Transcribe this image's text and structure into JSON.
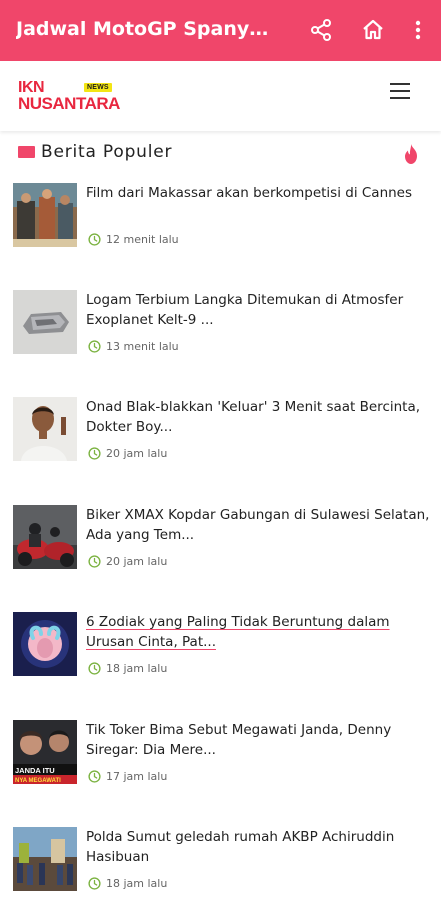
{
  "appbar": {
    "title": "Jadwal MotoGP Spanyol...",
    "icons": [
      "share-icon",
      "home-icon",
      "more-vert-icon"
    ],
    "color": "#f0466a"
  },
  "header": {
    "logo_line1": "IKN",
    "logo_line2": "NUSANTARA",
    "logo_badge": "NEWS",
    "logo_color": "#e8273f",
    "badge_color": "#f3e514"
  },
  "section": {
    "title": "Berita Populer",
    "icon": "fire-icon"
  },
  "articles": [
    {
      "headline": "Film dari Makassar akan berkompetisi di Cannes",
      "time": "12 menit lalu",
      "visited": false
    },
    {
      "headline": "Logam Terbium Langka Ditemukan di Atmosfer Exoplanet Kelt-9 ...",
      "time": "13 menit lalu",
      "visited": false
    },
    {
      "headline": "Onad Blak-blakkan 'Keluar' 3 Menit saat Bercinta, Dokter Boy...",
      "time": "20 jam lalu",
      "visited": false
    },
    {
      "headline": "Biker XMAX Kopdar Gabungan di Sulawesi Selatan, Ada yang Tem...",
      "time": "20 jam lalu",
      "visited": false
    },
    {
      "headline": "6 Zodiak yang Paling Tidak Beruntung dalam Urusan Cinta, Pat...",
      "time": "18 jam lalu",
      "visited": true
    },
    {
      "headline": "Tik Toker Bima Sebut Megawati Janda, Denny Siregar: Dia Mere...",
      "time": "17 jam lalu",
      "visited": false
    },
    {
      "headline": "Polda Sumut geledah rumah AKBP Achiruddin Hasibuan",
      "time": "18 jam lalu",
      "visited": false
    }
  ],
  "thumb_texts": {
    "item6_line1": "JANDA ITU",
    "item6_line2": "NYA MEGAWATI"
  }
}
